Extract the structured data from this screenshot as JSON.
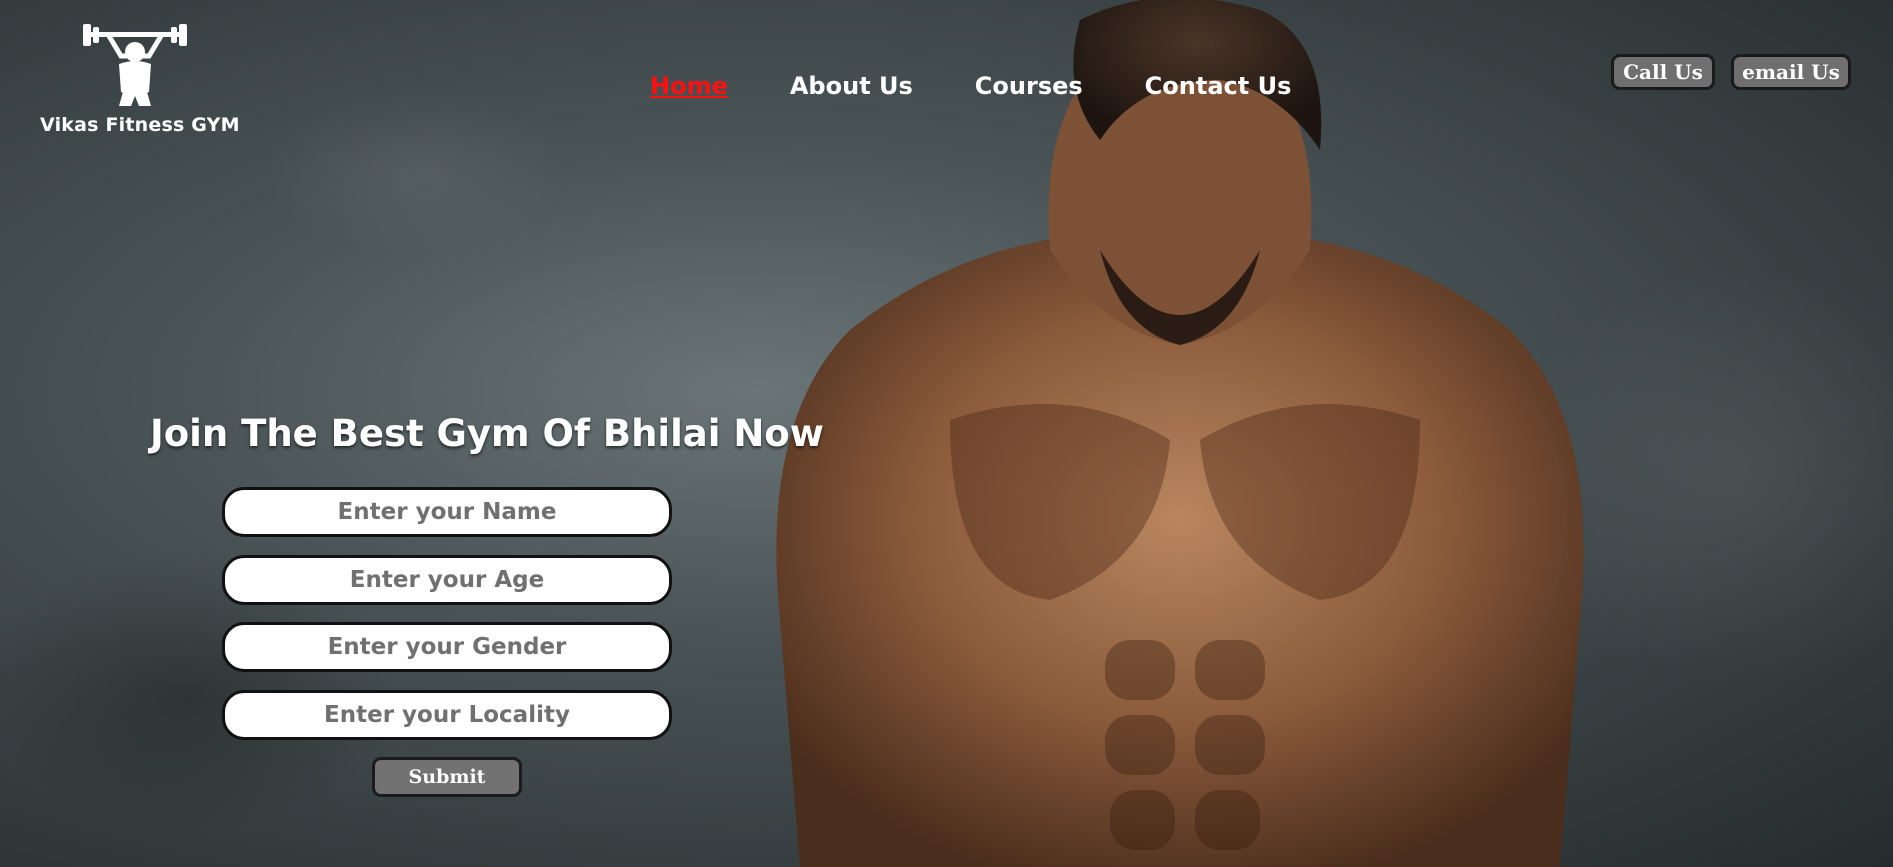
{
  "brand": {
    "name": "Vikas Fitness GYM",
    "logo_icon": "weightlifter-icon"
  },
  "nav": {
    "items": [
      {
        "label": "Home",
        "active": true
      },
      {
        "label": "About Us",
        "active": false
      },
      {
        "label": "Courses",
        "active": false
      },
      {
        "label": "Contact Us",
        "active": false
      }
    ]
  },
  "actions": {
    "call_label": "Call Us",
    "email_label": "email Us"
  },
  "form": {
    "title": "Join The Best Gym Of Bhilai Now",
    "name_placeholder": "Enter your Name",
    "age_placeholder": "Enter your Age",
    "gender_placeholder": "Enter your Gender",
    "locality_placeholder": "Enter your Locality",
    "submit_label": "Submit"
  },
  "colors": {
    "active_nav": "#ff1010",
    "pill_bg": "#6f6f6f",
    "text": "#ffffff"
  },
  "hero": {
    "image_subject": "muscular-man-photo"
  }
}
